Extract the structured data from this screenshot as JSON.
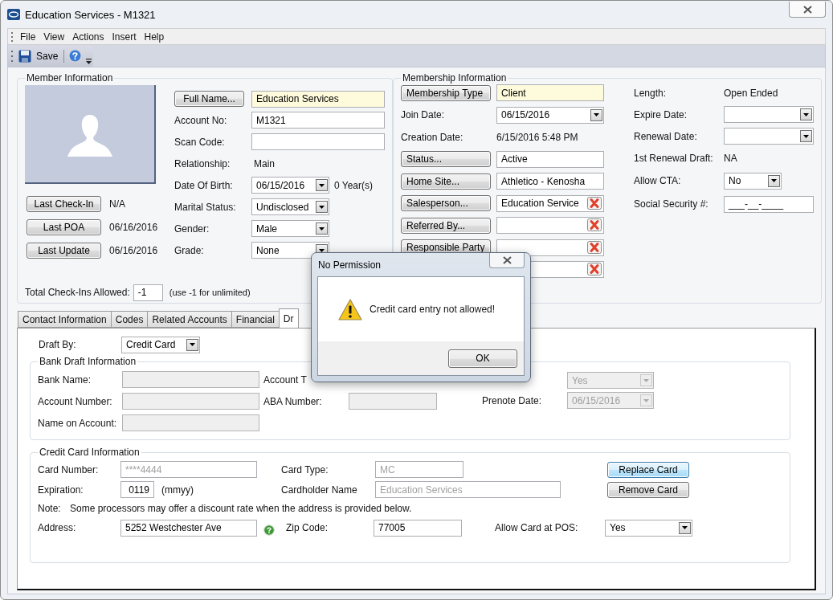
{
  "window": {
    "title": "Education Services - M1321"
  },
  "menu": [
    "File",
    "View",
    "Actions",
    "Insert",
    "Help"
  ],
  "toolbar": {
    "save": "Save"
  },
  "member": {
    "legend": "Member Information",
    "name_button": "Full Name...",
    "name_value": "Education Services",
    "fields": [
      {
        "kind": "input",
        "label": "Account No:",
        "value": "M1321"
      },
      {
        "kind": "input",
        "label": "Scan Code:"
      },
      {
        "kind": "text",
        "label": "Relationship:",
        "value": "Main"
      },
      {
        "kind": "select",
        "label": "Date Of Birth:",
        "value": "06/15/2016",
        "suffix": "0 Year(s)"
      },
      {
        "kind": "select",
        "label": "Marital Status:",
        "value": "Undisclosed"
      },
      {
        "kind": "select",
        "label": "Gender:",
        "value": "Male"
      },
      {
        "kind": "select",
        "label": "Grade:",
        "value": "None"
      }
    ],
    "history": [
      {
        "button": "Last Check-In",
        "value": "N/A"
      },
      {
        "button": "Last POA",
        "value": "06/16/2016"
      },
      {
        "button": "Last Update",
        "value": "06/16/2016"
      }
    ],
    "checkins": {
      "label": "Total Check-Ins Allowed:",
      "value": "-1",
      "hint": "(use -1 for unlimited)"
    }
  },
  "membership": {
    "legend": "Membership Information",
    "left": [
      {
        "kind": "button",
        "label": "Membership Type",
        "value": "Client",
        "highlight": true,
        "clearable": false
      },
      {
        "kind": "select",
        "label": "Join Date:",
        "value": "06/15/2016"
      },
      {
        "kind": "text",
        "label": "Creation Date:",
        "value": "6/15/2016 5:48 PM"
      },
      {
        "kind": "button",
        "label": "Status...",
        "value": "Active",
        "highlight": false,
        "clearable": false
      },
      {
        "kind": "button",
        "label": "Home Site...",
        "value": "Athletico - Kenosha",
        "highlight": false,
        "clearable": false
      },
      {
        "kind": "button",
        "label": "Salesperson...",
        "value": "Education Service",
        "highlight": false,
        "clearable": true
      },
      {
        "kind": "button",
        "label": "Referred By...",
        "highlight": false,
        "clearable": true
      },
      {
        "kind": "button",
        "label": "Responsible Party",
        "highlight": false,
        "clearable": true
      },
      {
        "kind": "field",
        "highlight": false,
        "clearable": true
      }
    ],
    "right": [
      {
        "kind": "text",
        "label": "Length:",
        "value": "Open Ended"
      },
      {
        "kind": "select",
        "label": "Expire Date:"
      },
      {
        "kind": "select",
        "label": "Renewal Date:"
      },
      {
        "kind": "text",
        "label": "1st Renewal Draft:",
        "value": "NA"
      },
      {
        "kind": "short-select",
        "label": "Allow CTA:",
        "value": "No"
      },
      {
        "kind": "input",
        "label": "Social Security #:",
        "value": "___-__-____"
      }
    ]
  },
  "tabs": [
    {
      "label": "Contact Information",
      "selected": false
    },
    {
      "label": "Codes",
      "selected": false
    },
    {
      "label": "Related Accounts",
      "selected": false
    },
    {
      "label": "Financial",
      "selected": false
    },
    {
      "label": "Dr",
      "selected": true
    }
  ],
  "draft": {
    "label": "Draft By:",
    "value": "Credit Card"
  },
  "bank": {
    "legend": "Bank Draft Information",
    "col1": [
      {
        "kind": "input",
        "label": "Bank Name:",
        "disabled": true
      },
      {
        "kind": "input",
        "label": "Account Number:",
        "disabled": true
      },
      {
        "kind": "input",
        "label": "Name on Account:",
        "disabled": true
      }
    ],
    "col2": [
      {
        "kind": "text",
        "label": "Account T"
      },
      {
        "kind": "input",
        "label": "ABA Number:",
        "disabled": true
      }
    ],
    "col3": [
      {
        "kind": "select",
        "value": "Yes",
        "disabled": true
      },
      {
        "kind": "select",
        "label": "Prenote Date:",
        "value": "06/15/2016",
        "disabled": true
      }
    ]
  },
  "card": {
    "legend": "Credit Card Information",
    "card_number": {
      "label": "Card Number:",
      "value": "****4444",
      "disabled": true
    },
    "card_type": {
      "label": "Card Type:",
      "value": "MC",
      "disabled": true
    },
    "replace": {
      "label": "Replace Card",
      "focused": true
    },
    "expiration": {
      "label": "Expiration:",
      "value": "0119",
      "hint": "(mmyy)"
    },
    "cardholder": {
      "label": "Cardholder Name",
      "value": "Education Services",
      "disabled": true
    },
    "remove": {
      "label": "Remove Card",
      "focused": false
    },
    "note": {
      "label": "Note:",
      "text": "Some processors may offer a discount rate when the address is provided below."
    },
    "address": {
      "label": "Address:",
      "value": "5252 Westchester Ave"
    },
    "zip": {
      "label": "Zip Code:",
      "value": "77005"
    },
    "pos": {
      "label": "Allow Card at POS:",
      "value": "Yes"
    }
  },
  "dialog": {
    "title": "No Permission",
    "message": "Credit card entry not allowed!",
    "button": "OK"
  }
}
